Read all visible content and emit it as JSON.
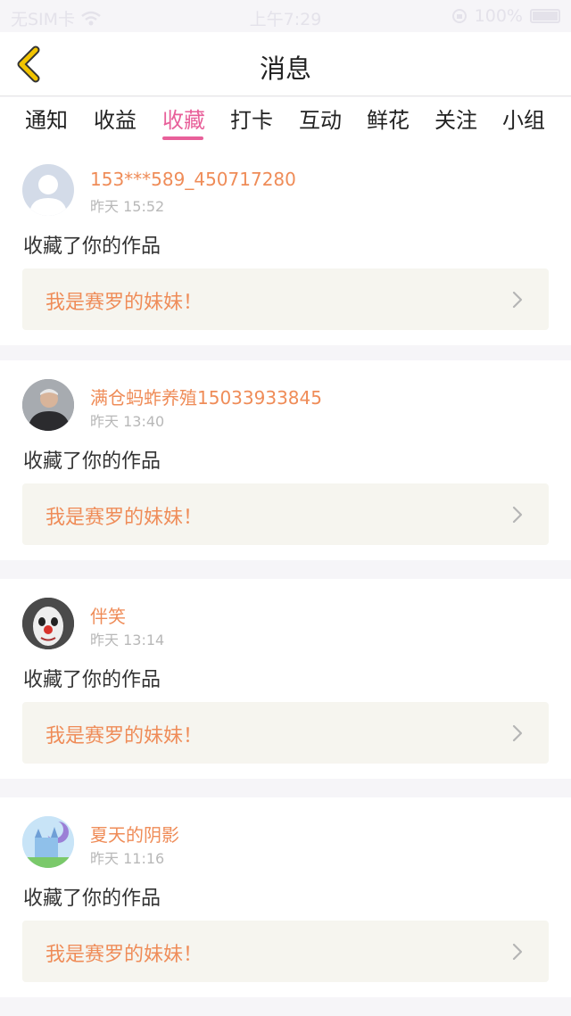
{
  "status_bar": {
    "carrier": "无SIM卡",
    "time": "上午7:29",
    "battery": "100%"
  },
  "navbar": {
    "title": "消息",
    "back_icon": "chevron-left-icon"
  },
  "tabs": [
    {
      "label": "通知",
      "active": false
    },
    {
      "label": "收益",
      "active": false
    },
    {
      "label": "收藏",
      "active": true
    },
    {
      "label": "打卡",
      "active": false
    },
    {
      "label": "互动",
      "active": false
    },
    {
      "label": "鲜花",
      "active": false
    },
    {
      "label": "关注",
      "active": false
    },
    {
      "label": "小组",
      "active": false
    }
  ],
  "notifications": [
    {
      "user": "153***589_450717280",
      "time": "昨天 15:52",
      "action": "收藏了你的作品",
      "work_title": "我是赛罗的妹妹！",
      "avatar": "default-avatar"
    },
    {
      "user": "满仓蚂蚱养殖15033933845",
      "time": "昨天 13:40",
      "action": "收藏了你的作品",
      "work_title": "我是赛罗的妹妹！",
      "avatar": "photo-man-avatar"
    },
    {
      "user": "伴笑",
      "time": "昨天 13:14",
      "action": "收藏了你的作品",
      "work_title": "我是赛罗的妹妹！",
      "avatar": "clown-face-avatar"
    },
    {
      "user": "夏天的阴影",
      "time": "昨天 11:16",
      "action": "收藏了你的作品",
      "work_title": "我是赛罗的妹妹！",
      "avatar": "castle-avatar"
    }
  ],
  "colors": {
    "accent_pink": "#e8609a",
    "username_orange": "#ef8c58",
    "back_icon_yellow": "#f2c400"
  }
}
